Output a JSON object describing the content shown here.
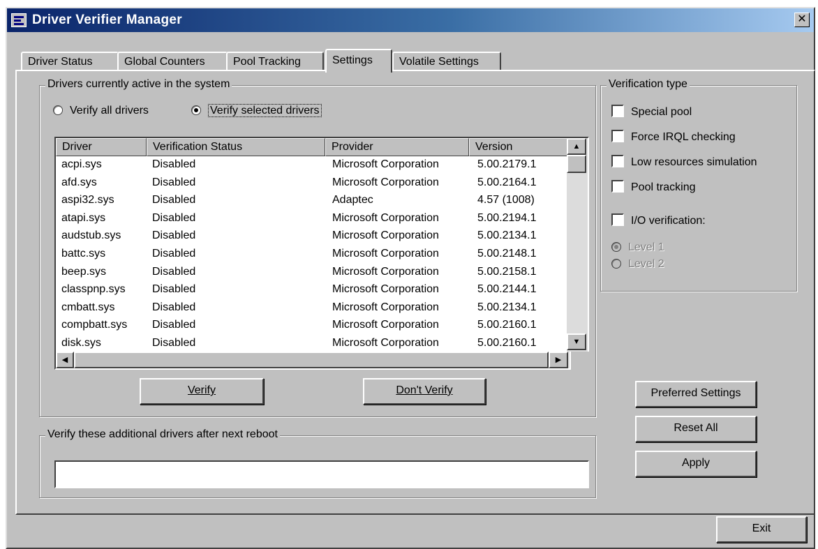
{
  "window": {
    "title": "Driver Verifier Manager",
    "close_label": "✕"
  },
  "tabs": [
    {
      "label": "Driver Status"
    },
    {
      "label": "Global Counters"
    },
    {
      "label": "Pool Tracking"
    },
    {
      "label": "Settings",
      "active": true
    },
    {
      "label": "Volatile Settings"
    }
  ],
  "drivers_group": {
    "label": "Drivers currently active in the system",
    "radio_all": {
      "label": "Verify all drivers",
      "selected": false
    },
    "radio_selected": {
      "label": "Verify selected drivers",
      "selected": true
    },
    "columns": [
      "Driver",
      "Verification Status",
      "Provider",
      "Version"
    ],
    "rows": [
      [
        "acpi.sys",
        "Disabled",
        "Microsoft Corporation",
        "5.00.2179.1"
      ],
      [
        "afd.sys",
        "Disabled",
        "Microsoft Corporation",
        "5.00.2164.1"
      ],
      [
        "aspi32.sys",
        "Disabled",
        "Adaptec",
        "4.57 (1008)"
      ],
      [
        "atapi.sys",
        "Disabled",
        "Microsoft Corporation",
        "5.00.2194.1"
      ],
      [
        "audstub.sys",
        "Disabled",
        "Microsoft Corporation",
        "5.00.2134.1"
      ],
      [
        "battc.sys",
        "Disabled",
        "Microsoft Corporation",
        "5.00.2148.1"
      ],
      [
        "beep.sys",
        "Disabled",
        "Microsoft Corporation",
        "5.00.2158.1"
      ],
      [
        "classpnp.sys",
        "Disabled",
        "Microsoft Corporation",
        "5.00.2144.1"
      ],
      [
        "cmbatt.sys",
        "Disabled",
        "Microsoft Corporation",
        "5.00.2134.1"
      ],
      [
        "compbatt.sys",
        "Disabled",
        "Microsoft Corporation",
        "5.00.2160.1"
      ],
      [
        "disk.sys",
        "Disabled",
        "Microsoft Corporation",
        "5.00.2160.1"
      ]
    ],
    "verify_button": "Verify",
    "dont_verify_button": "Don't Verify"
  },
  "additional_group": {
    "label": "Verify these additional drivers after next reboot",
    "value": ""
  },
  "verification_type": {
    "label": "Verification type",
    "options": [
      {
        "label": "Special pool",
        "checked": false
      },
      {
        "label": "Force IRQL checking",
        "checked": false
      },
      {
        "label": "Low resources simulation",
        "checked": false
      },
      {
        "label": "Pool tracking",
        "checked": false
      },
      {
        "label": "I/O verification:",
        "checked": false
      }
    ],
    "levels": [
      {
        "label": "Level 1",
        "selected": true
      },
      {
        "label": "Level 2",
        "selected": false
      }
    ]
  },
  "buttons": {
    "preferred": "Preferred Settings",
    "reset_all": "Reset All",
    "apply": "Apply",
    "exit": "Exit"
  },
  "scroll_icons": {
    "up": "▲",
    "down": "▼",
    "left": "◀",
    "right": "▶"
  }
}
